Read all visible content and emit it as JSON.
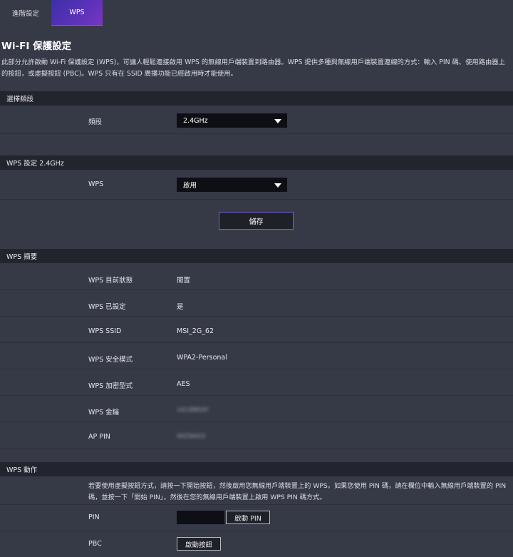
{
  "tabs": [
    {
      "label": "進階設定"
    },
    {
      "label": "WPS"
    }
  ],
  "page": {
    "title": "Wi-FI 保護設定",
    "description": "此部分允許啟動 Wi-Fi 保護設定 (WPS)，可讓人輕鬆連接啟用 WPS 的無線用戶端裝置到路由器。WPS 提供多種與無線用戶端裝置連線的方式：輸入 PIN 碼、使用路由器上的按鈕，或虛擬按鈕 (PBC)。WPS 只有在 SSID 廣播功能已經啟用時才能使用。"
  },
  "band_section": {
    "header": "選擇頻段",
    "label": "頻段",
    "selected": "2.4GHz"
  },
  "wps_settings": {
    "header": "WPS 設定 2.4GHz",
    "label": "WPS",
    "selected": "啟用",
    "save_label": "儲存"
  },
  "summary": {
    "header": "WPS 摘要",
    "rows": [
      {
        "label": "WPS 目前狀態",
        "value": "閒置"
      },
      {
        "label": "WPS 已設定",
        "value": "是"
      },
      {
        "label": "WPS SSID",
        "value": "MSI_2G_62"
      },
      {
        "label": "WPS 安全模式",
        "value": "WPA2-Personal"
      },
      {
        "label": "WPS 加密型式",
        "value": "AES"
      },
      {
        "label": "WPS 金鑰",
        "value": "14138829?"
      },
      {
        "label": "AP PIN",
        "value": "40256415"
      }
    ]
  },
  "action": {
    "header": "WPS 動作",
    "instructions": "若要使用虛擬按鈕方式，請按一下開始按鈕，然後啟用您無線用戶端裝置上的 WPS。如果您使用 PIN 碼，請在欄位中輸入無線用戶端裝置的 PIN 碼，並按一下「開始 PIN」，然後在您的無線用戶端裝置上啟用 WPS PIN 碼方式。",
    "pin_label": "PIN",
    "pin_value": "",
    "start_pin_label": "啟動 PIN",
    "pbc_label": "PBC",
    "start_button_label": "啟動按鈕"
  }
}
